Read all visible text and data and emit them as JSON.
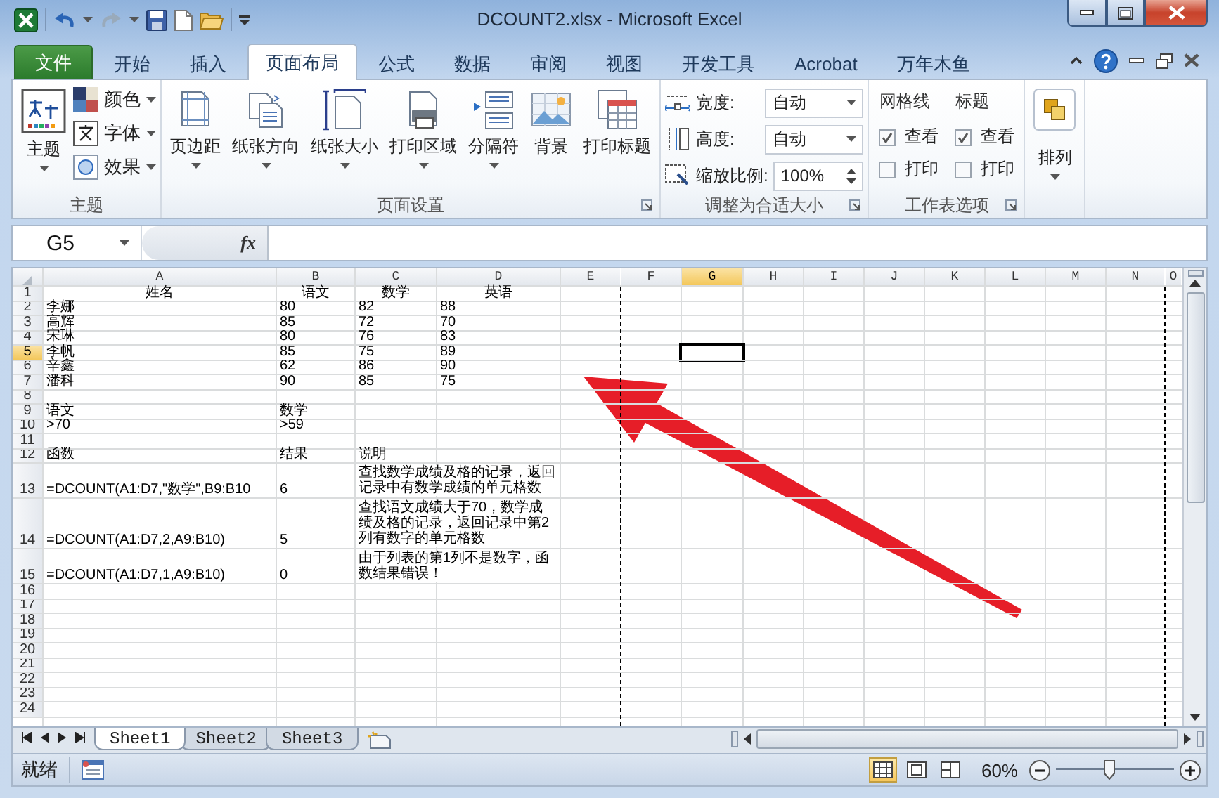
{
  "window": {
    "title": "DCOUNT2.xlsx  -  Microsoft Excel"
  },
  "ribbon_tabs": [
    {
      "label": "文件",
      "kind": "file",
      "selected": false
    },
    {
      "label": "开始",
      "kind": "tab",
      "selected": false
    },
    {
      "label": "插入",
      "kind": "tab",
      "selected": false
    },
    {
      "label": "页面布局",
      "kind": "tab",
      "selected": true
    },
    {
      "label": "公式",
      "kind": "tab",
      "selected": false
    },
    {
      "label": "数据",
      "kind": "tab",
      "selected": false
    },
    {
      "label": "审阅",
      "kind": "tab",
      "selected": false
    },
    {
      "label": "视图",
      "kind": "tab",
      "selected": false
    },
    {
      "label": "开发工具",
      "kind": "tab",
      "selected": false
    },
    {
      "label": "Acrobat",
      "kind": "tab",
      "selected": false
    },
    {
      "label": "万年木鱼",
      "kind": "tab",
      "selected": false
    }
  ],
  "ribbon_groups": [
    {
      "kind": "theme",
      "title": "主题",
      "launcher": false,
      "buttons": [
        {
          "label": "主题",
          "dropdown": true
        }
      ],
      "small": [
        {
          "label": "颜色",
          "dropdown": true
        },
        {
          "label": "字体",
          "dropdown": true
        },
        {
          "label": "效果",
          "dropdown": true
        }
      ]
    },
    {
      "kind": "buttons",
      "title": "页面设置",
      "launcher": true,
      "buttons": [
        {
          "label": "页边距",
          "dropdown": true
        },
        {
          "label": "纸张方向",
          "dropdown": true
        },
        {
          "label": "纸张大小",
          "dropdown": true
        },
        {
          "label": "打印区域",
          "dropdown": true
        },
        {
          "label": "分隔符",
          "dropdown": true
        },
        {
          "label": "背景",
          "dropdown": false
        },
        {
          "label": "打印标题",
          "dropdown": false
        }
      ]
    },
    {
      "kind": "fit",
      "title": "调整为合适大小",
      "launcher": true,
      "fields": [
        {
          "label": "宽度:",
          "value": "自动",
          "kind": "dropdown"
        },
        {
          "label": "高度:",
          "value": "自动",
          "kind": "dropdown"
        },
        {
          "label": "缩放比例:",
          "value": "100%",
          "kind": "spinner"
        }
      ]
    },
    {
      "kind": "options",
      "title": "工作表选项",
      "launcher": true,
      "columns": [
        {
          "heading": "网格线",
          "options": [
            {
              "label": "查看",
              "checked": true
            },
            {
              "label": "打印",
              "checked": false
            }
          ]
        },
        {
          "heading": "标题",
          "options": [
            {
              "label": "查看",
              "checked": true
            },
            {
              "label": "打印",
              "checked": false
            }
          ]
        }
      ]
    },
    {
      "kind": "arrange",
      "launcher": false,
      "buttons": [
        {
          "label": "排列",
          "dropdown": true
        }
      ]
    }
  ],
  "formula_bar": {
    "name_box": "G5",
    "function_label": "fx"
  },
  "sheet": {
    "columns": [
      {
        "label": "A",
        "selected": false,
        "page_break": false
      },
      {
        "label": "B",
        "selected": false,
        "page_break": false
      },
      {
        "label": "C",
        "selected": false,
        "page_break": false
      },
      {
        "label": "D",
        "selected": false,
        "page_break": false
      },
      {
        "label": "E",
        "selected": false,
        "page_break": true
      },
      {
        "label": "F",
        "selected": false,
        "page_break": false
      },
      {
        "label": "G",
        "selected": true,
        "page_break": false
      },
      {
        "label": "H",
        "selected": false,
        "page_break": false
      },
      {
        "label": "I",
        "selected": false,
        "page_break": false
      },
      {
        "label": "J",
        "selected": false,
        "page_break": false
      },
      {
        "label": "K",
        "selected": false,
        "page_break": false
      },
      {
        "label": "L",
        "selected": false,
        "page_break": false
      },
      {
        "label": "M",
        "selected": false,
        "page_break": false
      },
      {
        "label": "N",
        "selected": false,
        "page_break": true
      },
      {
        "label": "O",
        "selected": false,
        "page_break": false
      }
    ],
    "rows": [
      {
        "header": "1",
        "kind": "header",
        "selected": false,
        "cells": [
          "姓名",
          "语文",
          "数学",
          "英语"
        ]
      },
      {
        "header": "2",
        "kind": "data",
        "selected": false,
        "cells": [
          "李娜",
          "80",
          "82",
          "88"
        ]
      },
      {
        "header": "3",
        "kind": "data",
        "selected": false,
        "cells": [
          "高辉",
          "85",
          "72",
          "70"
        ]
      },
      {
        "header": "4",
        "kind": "data",
        "selected": false,
        "cells": [
          "宋琳",
          "80",
          "76",
          "83"
        ]
      },
      {
        "header": "5",
        "kind": "data",
        "selected": true,
        "cells": [
          "李帆",
          "85",
          "75",
          "89"
        ]
      },
      {
        "header": "6",
        "kind": "data",
        "selected": false,
        "cells": [
          "辛鑫",
          "62",
          "86",
          "90"
        ]
      },
      {
        "header": "7",
        "kind": "data",
        "selected": false,
        "cells": [
          "潘科",
          "90",
          "85",
          "75"
        ]
      },
      {
        "header": "8",
        "kind": "data",
        "selected": false
      },
      {
        "header": "9",
        "kind": "data",
        "selected": false,
        "cells": [
          "语文",
          "数学",
          null,
          null
        ]
      },
      {
        "header": "10",
        "kind": "data",
        "selected": false,
        "cells": [
          ">70",
          ">59",
          null,
          null
        ]
      },
      {
        "header": "11",
        "kind": "data",
        "selected": false
      },
      {
        "header": "12",
        "kind": "data",
        "selected": false,
        "cells": [
          "函数",
          "结果",
          "说明",
          null
        ]
      },
      {
        "header": "13",
        "kind": "tall",
        "selected": false,
        "cells": [
          "=DCOUNT(A1:D7,\"数学\",B9:B10",
          "6",
          "查找数学成绩及格的记录，返回记录中有数学成绩的单元格数",
          null
        ]
      },
      {
        "header": "14",
        "kind": "tall",
        "selected": false,
        "cells": [
          "=DCOUNT(A1:D7,2,A9:B10)",
          "5",
          "查找语文成绩大于70，数学成绩及格的记录，返回记录中第2列有数字的单元格数",
          null
        ]
      },
      {
        "header": "15",
        "kind": "tall",
        "selected": false,
        "cells": [
          "=DCOUNT(A1:D7,1,A9:B10)",
          "0",
          "由于列表的第1列不是数字，函数结果错误！",
          null
        ]
      },
      {
        "header": "16",
        "kind": "data",
        "selected": false
      },
      {
        "header": "17",
        "kind": "data",
        "selected": false
      },
      {
        "header": "18",
        "kind": "data",
        "selected": false
      },
      {
        "header": "19",
        "kind": "data",
        "selected": false
      },
      {
        "header": "20",
        "kind": "data",
        "selected": false
      },
      {
        "header": "21",
        "kind": "data",
        "selected": false
      },
      {
        "header": "22",
        "kind": "data",
        "selected": false
      },
      {
        "header": "23",
        "kind": "data",
        "selected": false
      },
      {
        "header": "24",
        "kind": "data",
        "selected": false
      }
    ]
  },
  "sheet_tabs": [
    {
      "label": "Sheet1",
      "selected": true
    },
    {
      "label": "Sheet2",
      "selected": false
    },
    {
      "label": "Sheet3",
      "selected": false
    }
  ],
  "status_bar": {
    "status": "就绪",
    "views": [
      {
        "selected": true
      },
      {
        "selected": false
      },
      {
        "selected": false
      }
    ],
    "zoom": "60%",
    "zoom_slider": {
      "level": 0.45
    }
  }
}
